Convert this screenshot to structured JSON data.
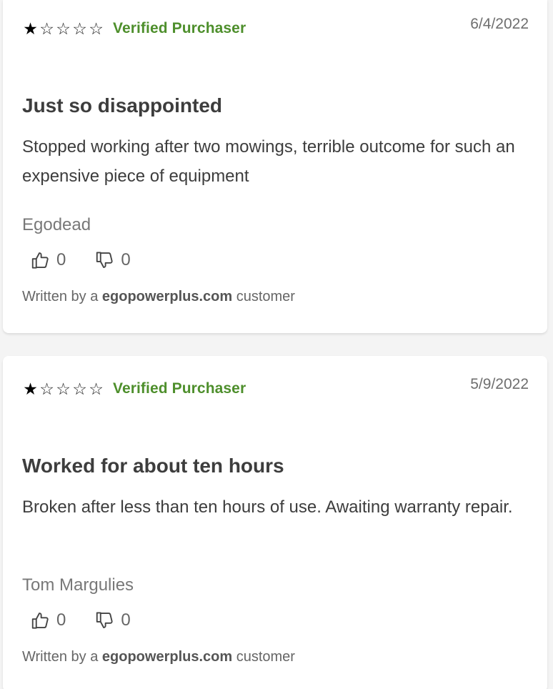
{
  "colors": {
    "verified": "#4e8f2c",
    "card_bg": "#ffffff",
    "page_bg": "#f4f4f4"
  },
  "reviews": [
    {
      "rating": 1,
      "max_rating": 5,
      "verified_label": "Verified Purchaser",
      "date": "6/4/2022",
      "title": "Just so disappointed",
      "body": "Stopped working after two mowings, terrible outcome for such an expensive piece of equipment",
      "author": "Egodead",
      "helpful_count": "0",
      "unhelpful_count": "0",
      "byline_prefix": "Written by a",
      "byline_site": "egopowerplus.com",
      "byline_suffix": "customer"
    },
    {
      "rating": 1,
      "max_rating": 5,
      "verified_label": "Verified Purchaser",
      "date": "5/9/2022",
      "title": "Worked for about ten hours",
      "body": "Broken after less than ten hours of use. Awaiting warranty repair.",
      "author": "Tom Margulies",
      "helpful_count": "0",
      "unhelpful_count": "0",
      "byline_prefix": "Written by a",
      "byline_site": "egopowerplus.com",
      "byline_suffix": "customer"
    }
  ],
  "icons": {
    "star_filled": "★",
    "star_empty": "☆",
    "thumbs_up": "thumbs-up-icon",
    "thumbs_down": "thumbs-down-icon"
  }
}
